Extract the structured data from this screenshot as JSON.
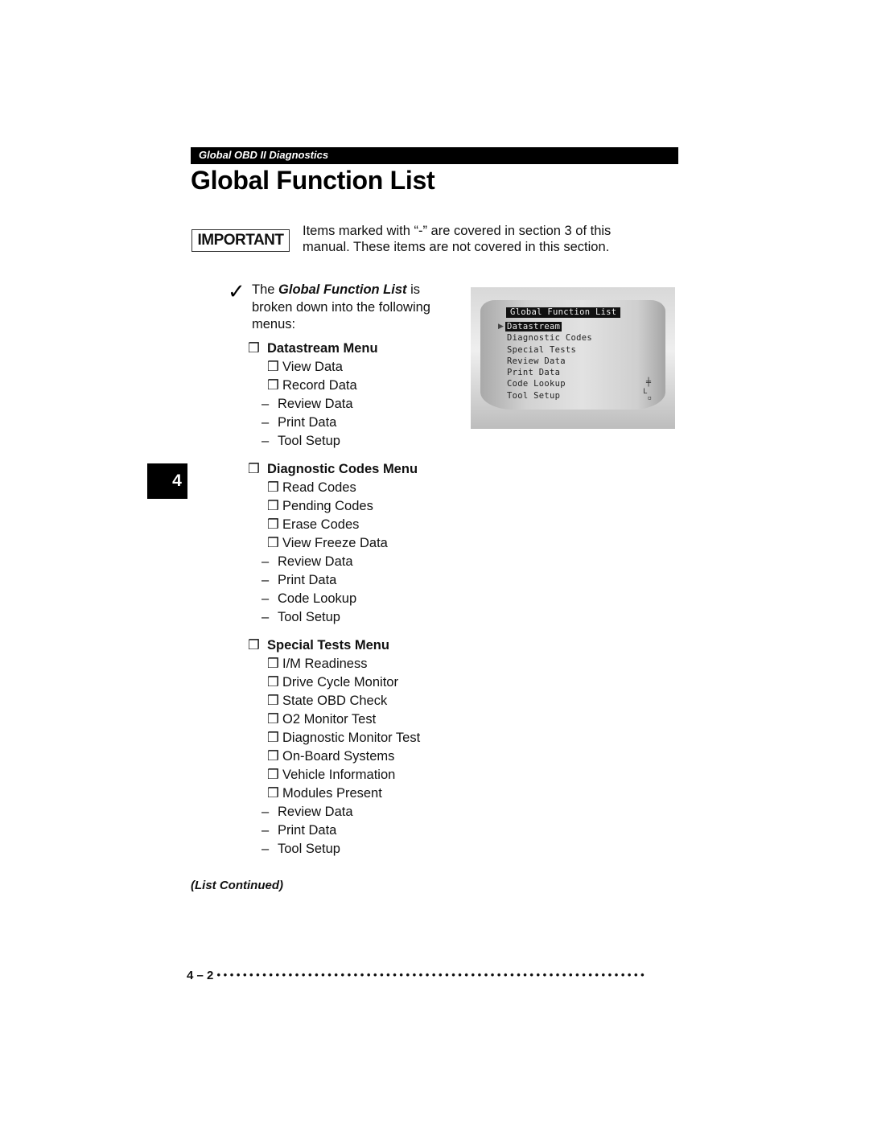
{
  "header": {
    "section": "Global OBD II Diagnostics"
  },
  "page_title": "Global Function List",
  "important": {
    "badge": "IMPORTANT",
    "line1": "Items marked with “-” are covered in section 3 of this",
    "line2": "manual. These items are not covered in this section."
  },
  "intro": {
    "pre": "The ",
    "emph": "Global Function List",
    "post": " is broken down into the following menus:"
  },
  "icons": {
    "check": "✓",
    "box": "❒",
    "dash": "–",
    "arrow": "▶"
  },
  "menus": [
    {
      "title": "Datastream Menu",
      "items": [
        {
          "marker": "box",
          "label": "View Data"
        },
        {
          "marker": "box",
          "label": "Record Data"
        },
        {
          "marker": "dash",
          "label": "Review Data"
        },
        {
          "marker": "dash",
          "label": "Print Data"
        },
        {
          "marker": "dash",
          "label": "Tool Setup"
        }
      ]
    },
    {
      "title": "Diagnostic Codes Menu",
      "items": [
        {
          "marker": "box",
          "label": "Read Codes"
        },
        {
          "marker": "box",
          "label": "Pending Codes"
        },
        {
          "marker": "box",
          "label": "Erase Codes"
        },
        {
          "marker": "box",
          "label": "View Freeze Data"
        },
        {
          "marker": "dash",
          "label": "Review Data"
        },
        {
          "marker": "dash",
          "label": "Print Data"
        },
        {
          "marker": "dash",
          "label": "Code Lookup"
        },
        {
          "marker": "dash",
          "label": "Tool Setup"
        }
      ]
    },
    {
      "title": "Special Tests Menu",
      "items": [
        {
          "marker": "box",
          "label": "I/M Readiness"
        },
        {
          "marker": "box",
          "label": "Drive Cycle Monitor"
        },
        {
          "marker": "box",
          "label": "State OBD Check"
        },
        {
          "marker": "box",
          "label": "O2 Monitor Test"
        },
        {
          "marker": "box",
          "label": "Diagnostic Monitor Test"
        },
        {
          "marker": "box",
          "label": "On-Board Systems"
        },
        {
          "marker": "box",
          "label": "Vehicle Information"
        },
        {
          "marker": "box",
          "label": "Modules Present"
        },
        {
          "marker": "dash",
          "label": "Review Data"
        },
        {
          "marker": "dash",
          "label": "Print Data"
        },
        {
          "marker": "dash",
          "label": "Tool Setup"
        }
      ]
    }
  ],
  "chapter_tab": "4",
  "list_continued": "(List Continued)",
  "footer": {
    "page_number": "4 – 2"
  },
  "device_screen": {
    "title": "Global Function List",
    "selected_index": 0,
    "items": [
      "Datastream",
      "Diagnostic Codes",
      "Special Tests",
      "Review Data",
      "Print Data",
      "Code Lookup",
      "Tool Setup"
    ]
  }
}
